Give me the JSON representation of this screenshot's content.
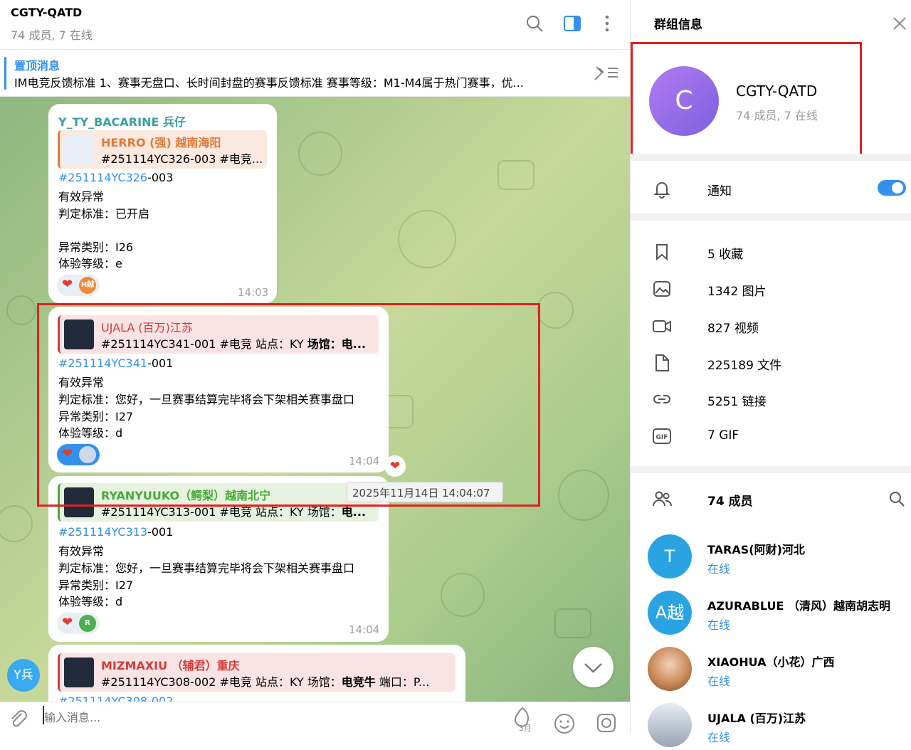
{
  "chat": {
    "title": "CGTY-QATD",
    "subtitle": "74 成员, 7 在线",
    "pinned_title": "置顶消息",
    "pinned_text": "IM电竞反馈标准 1、赛事无盘口、长时间封盘的赛事反馈标准 赛事等级：M1-M4属于热门赛事，优...",
    "messages": [
      {
        "sender": "Y_TY_BACARINE 兵仔",
        "reply_name": "HERRO (强)   越南海阳",
        "reply_text": "#251114YC326-003 #电竞...",
        "tag": "#251114YC326",
        "tag_rest": "-003",
        "lines": [
          "有效异常",
          "判定标准：已开启",
          "",
          "异常类别：I26",
          "体验等级：e"
        ],
        "time": "14:03",
        "reaction_avatar": "H越"
      },
      {
        "reply_name": "UJALA (百万)江苏",
        "reply_text_a": "#251114YC341-001 #电竞 站点：KY ",
        "reply_text_b": "场馆：电...",
        "tag": "#251114YC341",
        "tag_rest": "-001",
        "lines": [
          "有效异常",
          "判定标准：您好，一旦赛事结算完毕将会下架相关赛事盘口",
          "异常类别：I27",
          "体验等级：d"
        ],
        "time": "14:04"
      },
      {
        "reply_name": "RYANYUUKO（鳄梨）越南北宁",
        "reply_text_a": "#251114YC313-001 #电竞 站点：KY 场馆：",
        "reply_text_b": "电...",
        "tag": "#251114YC313",
        "tag_rest": "-001",
        "lines": [
          "有效异常",
          "判定标准：您好，一旦赛事结算完毕将会下架相关赛事盘口",
          "异常类别：I27",
          "体验等级：d"
        ],
        "time": "14:04",
        "reaction_avatar": "R"
      },
      {
        "reply_name": "MIZMAXIU （辅君）重庆",
        "reply_text_a": "#251114YC308-002 #电竞 站点：KY 场馆：",
        "reply_text_b": "电竞牛",
        "reply_text_c": " 端口：P...",
        "tag_partial": "#251114YC308-002"
      }
    ],
    "tooltip": "2025年11月14日 14:04:07",
    "sender_avatar": "Y兵",
    "input_placeholder": "输入消息...",
    "sticker_badge": "3月"
  },
  "panel": {
    "title": "群组信息",
    "group_avatar_letter": "C",
    "group_name": "CGTY-QATD",
    "group_sub": "74 成员, 7 在线",
    "notify_label": "通知",
    "media": [
      {
        "icon": "bookmark-icon",
        "label": "5 收藏"
      },
      {
        "icon": "photo-icon",
        "label": "1342 图片"
      },
      {
        "icon": "video-icon",
        "label": "827 视频"
      },
      {
        "icon": "file-icon",
        "label": "225189 文件"
      },
      {
        "icon": "link-icon",
        "label": "5251 链接"
      },
      {
        "icon": "gif-icon",
        "label": "7 GIF"
      }
    ],
    "members_label": "74 成员",
    "members": [
      {
        "avatar": "T",
        "name": "TARAS(阿财)河北",
        "status": "在线",
        "color": "#2aa3e2"
      },
      {
        "avatar": "A越",
        "name": "AZURABLUE （清风）越南胡志明",
        "status": "在线",
        "color": "#2aa3e2"
      },
      {
        "avatar": "",
        "name": "XIAOHUA（小花）广西",
        "status": "在线",
        "color": "#c98a5a"
      },
      {
        "avatar": "",
        "name": "UJALA (百万)江苏",
        "status": "在线",
        "color": "#d0d4dc"
      }
    ]
  },
  "colors": {
    "accent": "#3390ec",
    "highlight_box": "#e02020",
    "heart": "#e53935"
  }
}
